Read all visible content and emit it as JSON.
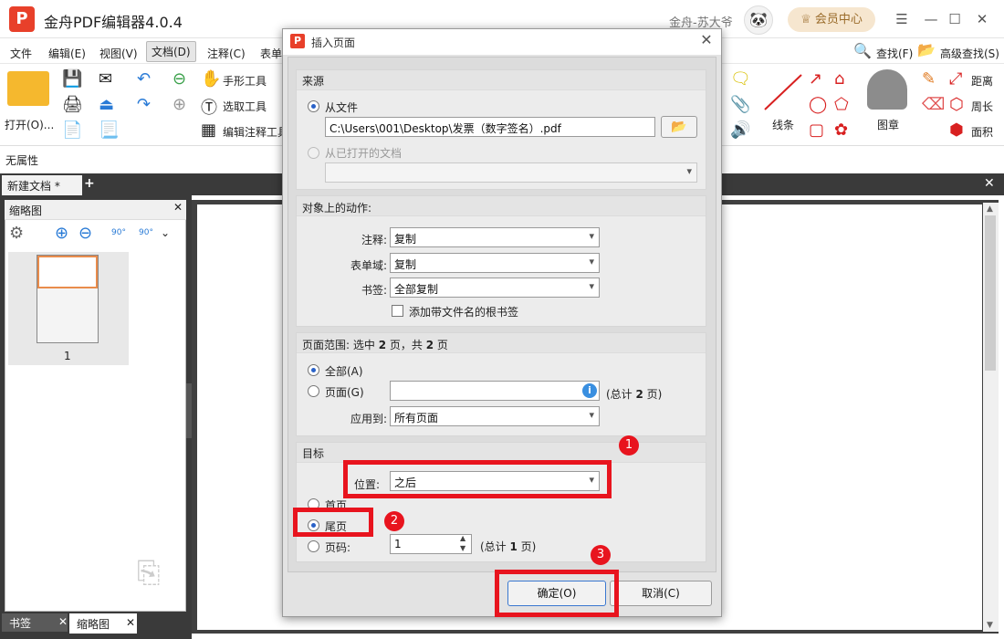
{
  "app": {
    "logo_letter": "P",
    "title": "金舟PDF编辑器4.0.4",
    "user_name": "金舟-苏大爷",
    "vip_label": "会员中心"
  },
  "menu": {
    "file": "文件",
    "edit": "编辑(E)",
    "view": "视图(V)",
    "document": "文档(D)",
    "annotate": "注释(C)",
    "form": "表单",
    "find": "查找(F)",
    "advanced_find": "高级查找(S)"
  },
  "ribbon": {
    "open": "打开(O)...",
    "hand_tool": "手形工具",
    "select_text": "选取工具",
    "edit_annotation": "编辑注释工具",
    "line": "线条",
    "stamp": "图章",
    "distance": "距离",
    "perimeter": "周长",
    "area": "面积"
  },
  "properties_label": "无属性",
  "doc_tab": "新建文档 *",
  "thumb_panel": {
    "title": "缩略图",
    "page_number": "1",
    "rotate_left": "90°",
    "rotate_right": "90°"
  },
  "bottom_tabs": {
    "bookmarks": "书签",
    "thumbnails": "缩略图"
  },
  "dialog": {
    "title": "插入页面",
    "source": {
      "heading": "来源",
      "from_file": "从文件",
      "file_path": "C:\\Users\\001\\Desktop\\发票（数字签名）.pdf",
      "from_open_doc": "从已打开的文档"
    },
    "actions": {
      "heading": "对象上的动作:",
      "annotation_label": "注释:",
      "annotation_value": "复制",
      "form_label": "表单域:",
      "form_value": "复制",
      "bookmark_label": "书签:",
      "bookmark_value": "全部复制",
      "add_root_bookmark": "添加带文件名的根书签"
    },
    "range": {
      "heading_prefix": "页面范围: 选中 ",
      "selected": "2",
      "heading_mid": " 页，共 ",
      "total": "2",
      "heading_suffix": " 页",
      "all": "全部(A)",
      "pages": "页面(G)",
      "pages_total_prefix": "(总计 ",
      "pages_total_value": "2",
      "pages_total_suffix": " 页)",
      "apply_to_label": "应用到:",
      "apply_to_value": "所有页面"
    },
    "target": {
      "heading": "目标",
      "position_label": "位置:",
      "position_value": "之后",
      "first_page": "首页",
      "last_page": "尾页",
      "page_number": "页码:",
      "page_number_value": "1",
      "page_total_prefix": "(总计 ",
      "page_total_value": "1",
      "page_total_suffix": " 页)"
    },
    "ok": "确定(O)",
    "cancel": "取消(C)"
  },
  "annotations": {
    "step1": "1",
    "step2": "2",
    "step3": "3"
  },
  "colors": {
    "highlight_red": "#e8141e",
    "brand_red": "#e8402a",
    "thumb_selected": "#e98c4c"
  }
}
